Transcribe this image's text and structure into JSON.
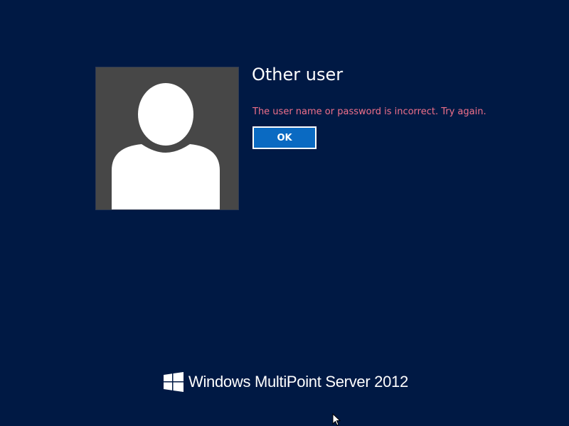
{
  "user": {
    "name": "Other user",
    "avatar_icon": "user-silhouette-icon"
  },
  "error": {
    "message": "The user name or password is incorrect. Try again.",
    "color": "#f0708a"
  },
  "buttons": {
    "ok_label": "OK",
    "accent": "#0a6ac2"
  },
  "branding": {
    "logo_icon": "windows-logo-icon",
    "product_name": "Windows MultiPoint Server 2012"
  },
  "pointer": {
    "icon": "mouse-pointer-icon"
  },
  "theme": {
    "background": "#001944"
  }
}
